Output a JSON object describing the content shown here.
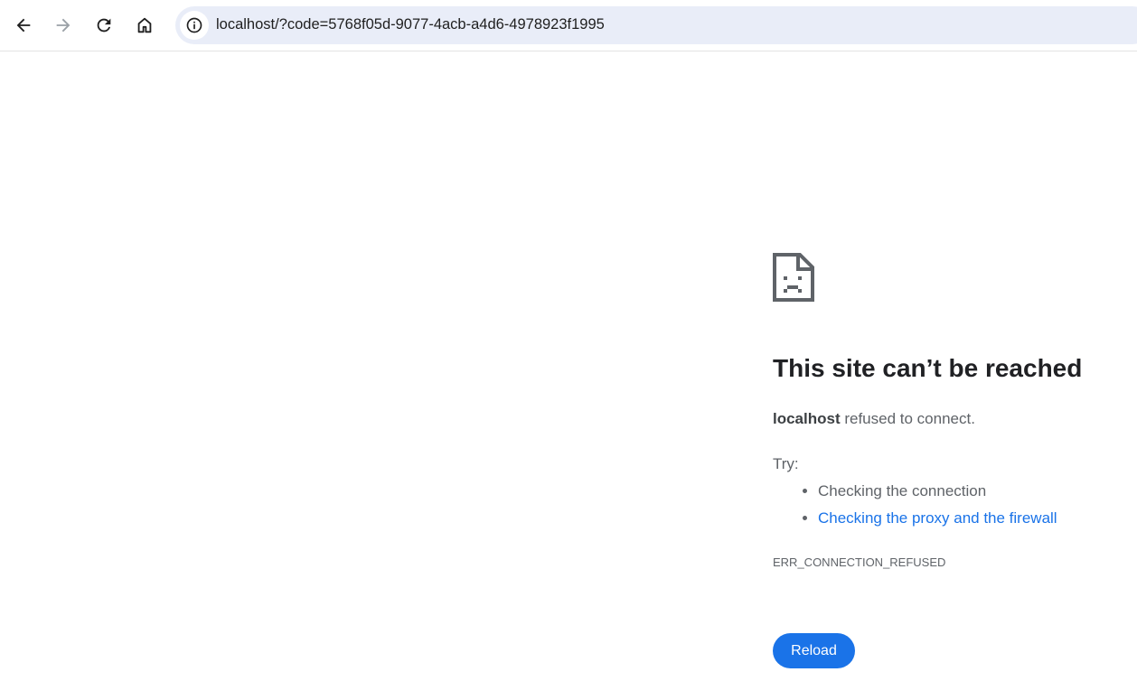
{
  "browser": {
    "url": "localhost/?code=5768f05d-9077-4acb-a4d6-4978923f1995",
    "icons": {
      "back": "arrow-left-icon",
      "forward": "arrow-right-icon",
      "reload": "reload-icon",
      "home": "home-icon",
      "site_info": "info-icon"
    },
    "forward_enabled": false
  },
  "error_page": {
    "icon": "sad-file-icon",
    "title": "This site can’t be reached",
    "summary_host": "localhost",
    "summary_text": " refused to connect.",
    "try_label": "Try:",
    "suggestions": [
      "Checking the connection",
      "Checking the proxy and the firewall"
    ],
    "error_code": "ERR_CONNECTION_REFUSED",
    "reload_label": "Reload"
  },
  "colors": {
    "accent": "#1a73e8",
    "omnibox_bg": "#e9edf8",
    "title_text": "#202124",
    "body_text": "#5f6368"
  }
}
